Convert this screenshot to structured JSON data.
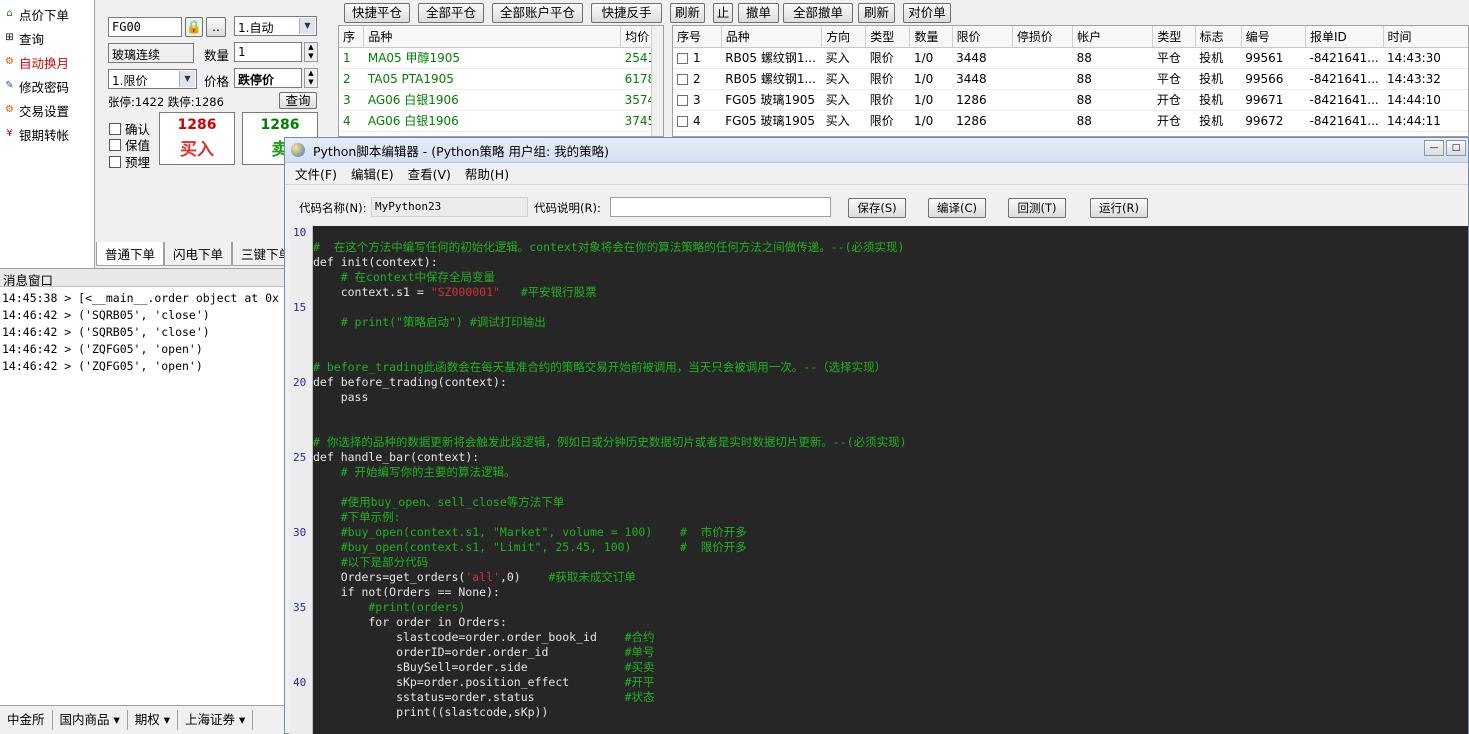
{
  "left_menu": [
    {
      "label": "点价下单",
      "icon": "shield-icon",
      "color": "#000000"
    },
    {
      "label": "查询",
      "icon": "plus-box-icon",
      "color": "#000000"
    },
    {
      "label": "自动换月",
      "icon": "gear-icon",
      "color": "#e00000"
    },
    {
      "label": "修改密码",
      "icon": "pencil-icon",
      "color": "#000000"
    },
    {
      "label": "交易设置",
      "icon": "gear-icon",
      "color": "#000000"
    },
    {
      "label": "银期转帐",
      "icon": "yen-icon",
      "color": "#000000"
    }
  ],
  "order_panel": {
    "contract_code": "FG00",
    "lock_icon": "lock-icon",
    "more_button": "..",
    "mode_select": "1.自动",
    "contract_name": "玻璃连续",
    "qty_label": "数量",
    "qty_value": "1",
    "price_type_select": "1.限价",
    "price_label": "价格",
    "price_value": "跌停价",
    "limit_info": "张停:1422 跌停:1286",
    "query_button": "查询",
    "confirm_label": "确认",
    "hedge_label": "保值",
    "preorder_label": "预埋",
    "buy_price": "1286",
    "buy_label": "买入",
    "sell_price": "1286",
    "sell_label": "卖"
  },
  "order_tabs": [
    "普通下单",
    "闪电下单",
    "三键下单"
  ],
  "message_window": {
    "title": "消息窗口",
    "lines": [
      "14:45:38 > [<__main__.order object at 0x",
      "14:46:42 > ('SQRB05', 'close')",
      "14:46:42 > ('SQRB05', 'close')",
      "14:46:42 > ('ZQFG05', 'open')",
      "14:46:42 > ('ZQFG05', 'open')"
    ]
  },
  "bottom_tabs": [
    "中金所",
    "国内商品 ▾",
    "期权 ▾",
    "上海证券 ▾"
  ],
  "toolbar": [
    "快捷平仓",
    "全部平仓",
    "全部账户平仓",
    "快捷反手",
    "刷新",
    "止",
    "撤单",
    "全部撤单",
    "刷新",
    "对价单"
  ],
  "quote_table": {
    "headers": [
      "序",
      "品种",
      "均价"
    ],
    "rows": [
      [
        "1",
        "MA05 甲醇1905",
        "2541"
      ],
      [
        "2",
        "TA05 PTA1905",
        "6178"
      ],
      [
        "3",
        "AG06 白银1906",
        "3574."
      ],
      [
        "4",
        "AG06 白银1906",
        "3745."
      ]
    ]
  },
  "order_table": {
    "headers": [
      "序号",
      "品种",
      "方向",
      "类型",
      "数量",
      "限价",
      "停损价",
      "帐户",
      "类型",
      "标志",
      "编号",
      "报单ID",
      "时间"
    ],
    "rows": [
      [
        "1",
        "RB05 螺纹钢1...",
        "买入",
        "限价",
        "1/0",
        "3448",
        "",
        "88",
        "平仓",
        "投机",
        "99561",
        "-8421641...",
        "14:43:30"
      ],
      [
        "2",
        "RB05 螺纹钢1...",
        "买入",
        "限价",
        "1/0",
        "3448",
        "",
        "88",
        "平仓",
        "投机",
        "99566",
        "-8421641...",
        "14:43:32"
      ],
      [
        "3",
        "FG05 玻璃1905",
        "买入",
        "限价",
        "1/0",
        "1286",
        "",
        "88",
        "开仓",
        "投机",
        "99671",
        "-8421641...",
        "14:44:10"
      ],
      [
        "4",
        "FG05 玻璃1905",
        "买入",
        "限价",
        "1/0",
        "1286",
        "",
        "88",
        "开仓",
        "投机",
        "99672",
        "-8421641...",
        "14:44:11"
      ]
    ]
  },
  "editor": {
    "title": "Python脚本编辑器 - (Python策略 用户组: 我的策略)",
    "menu": [
      "文件(F)",
      "编辑(E)",
      "查看(V)",
      "帮助(H)"
    ],
    "code_name_label": "代码名称(N):",
    "code_name_value": "MyPython23",
    "code_desc_label": "代码说明(R):",
    "code_desc_value": "",
    "buttons": [
      "保存(S)",
      "编译(C)",
      "回测(T)",
      "运行(R)"
    ],
    "line_numbers": [
      "10",
      "15",
      "20",
      "25",
      "30",
      "35",
      "40"
    ],
    "code_lines": [
      [
        {
          "t": "#  在这个方法中编写任何的初始化逻辑。context对象将会在你的算法策略的任何方法之间做传递。--(必须实现)",
          "c": "cm"
        }
      ],
      [
        {
          "t": "def ",
          "c": "kw"
        },
        {
          "t": "init(context):",
          "c": "fn"
        }
      ],
      [
        {
          "t": "    # 在context中保存全局变量",
          "c": "cm"
        }
      ],
      [
        {
          "t": "    context.s1 = ",
          "c": "fn"
        },
        {
          "t": "\"SZ000001\"",
          "c": "st"
        },
        {
          "t": "   #平安银行股票",
          "c": "cm"
        }
      ],
      [
        {
          "t": "",
          "c": "fn"
        }
      ],
      [
        {
          "t": "    # print(\"策略启动\") #调试打印输出",
          "c": "cm"
        }
      ],
      [
        {
          "t": "",
          "c": "fn"
        }
      ],
      [
        {
          "t": "",
          "c": "fn"
        }
      ],
      [
        {
          "t": "# before_trading此函数会在每天基准合约的策略交易开始前被调用，当天只会被调用一次。--（选择实现）",
          "c": "cm"
        }
      ],
      [
        {
          "t": "def ",
          "c": "kw"
        },
        {
          "t": "before_trading(context):",
          "c": "fn"
        }
      ],
      [
        {
          "t": "    pass",
          "c": "kw"
        }
      ],
      [
        {
          "t": "",
          "c": "fn"
        }
      ],
      [
        {
          "t": "",
          "c": "fn"
        }
      ],
      [
        {
          "t": "# 你选择的品种的数据更新将会触发此段逻辑，例如日或分钟历史数据切片或者是实时数据切片更新。--(必须实现)",
          "c": "cm"
        }
      ],
      [
        {
          "t": "def ",
          "c": "kw"
        },
        {
          "t": "handle_bar(context):",
          "c": "fn"
        }
      ],
      [
        {
          "t": "    # 开始编写你的主要的算法逻辑。",
          "c": "cm"
        }
      ],
      [
        {
          "t": "",
          "c": "fn"
        }
      ],
      [
        {
          "t": "    #使用buy_open、sell_close等方法下单",
          "c": "cm"
        }
      ],
      [
        {
          "t": "    #下单示例:",
          "c": "cm"
        }
      ],
      [
        {
          "t": "    #buy_open(context.s1, \"Market\", volume = 100)    #  市价开多",
          "c": "cm"
        }
      ],
      [
        {
          "t": "    #buy_open(context.s1, \"Limit\", 25.45, 100)       #  限价开多",
          "c": "cm"
        }
      ],
      [
        {
          "t": "    #以下是部分代码",
          "c": "cm"
        }
      ],
      [
        {
          "t": "    Orders=get_orders(",
          "c": "fn"
        },
        {
          "t": "'all'",
          "c": "st"
        },
        {
          "t": ",0)",
          "c": "fn"
        },
        {
          "t": "    #获取未成交订单",
          "c": "cm"
        }
      ],
      [
        {
          "t": "    if not",
          "c": "kw"
        },
        {
          "t": "(Orders == None):",
          "c": "fn"
        }
      ],
      [
        {
          "t": "        #print(orders)",
          "c": "cm"
        }
      ],
      [
        {
          "t": "        for ",
          "c": "kw"
        },
        {
          "t": "order ",
          "c": "fn"
        },
        {
          "t": "in ",
          "c": "kw"
        },
        {
          "t": "Orders:",
          "c": "fn"
        }
      ],
      [
        {
          "t": "            slastcode=order.order_book_id    ",
          "c": "fn"
        },
        {
          "t": "#合约",
          "c": "cm"
        }
      ],
      [
        {
          "t": "            orderID=order.order_id           ",
          "c": "fn"
        },
        {
          "t": "#单号",
          "c": "cm"
        }
      ],
      [
        {
          "t": "            sBuySell=order.side              ",
          "c": "fn"
        },
        {
          "t": "#买卖",
          "c": "cm"
        }
      ],
      [
        {
          "t": "            sKp=order.position_effect        ",
          "c": "fn"
        },
        {
          "t": "#开平",
          "c": "cm"
        }
      ],
      [
        {
          "t": "            sstatus=order.status             ",
          "c": "fn"
        },
        {
          "t": "#状态",
          "c": "cm"
        }
      ],
      [
        {
          "t": "            print((slastcode,sKp))",
          "c": "fn"
        }
      ]
    ]
  }
}
